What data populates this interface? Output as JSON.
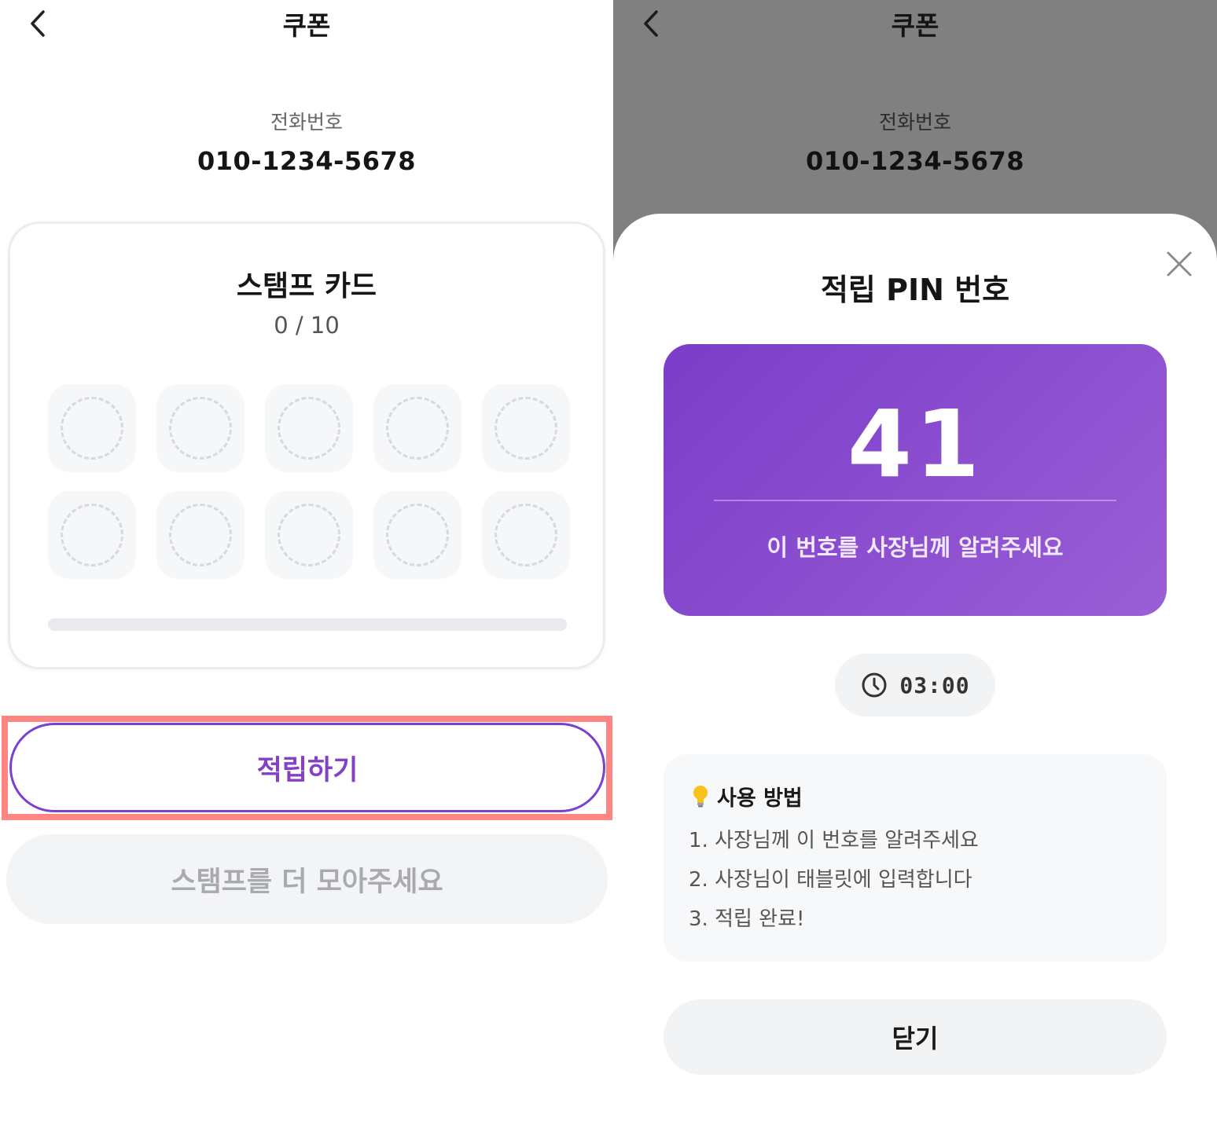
{
  "left": {
    "header": {
      "title": "쿠폰"
    },
    "phone": {
      "label": "전화번호",
      "value": "010-1234-5678"
    },
    "stamp_card": {
      "title": "스탬프 카드",
      "count_text": "0 / 10",
      "collected": 0,
      "total": 10,
      "progress_fraction": 0
    },
    "buttons": {
      "earn_label": "적립하기",
      "collect_more_label": "스탬프를 더 모아주세요"
    }
  },
  "right": {
    "header": {
      "title": "쿠폰"
    },
    "phone": {
      "label": "전화번호",
      "value": "010-1234-5678"
    },
    "modal": {
      "title": "적립 PIN 번호",
      "pin": "41",
      "pin_hint": "이 번호를 사장님께 알려주세요",
      "timer": "03:00",
      "howto": {
        "title": "사용 방법",
        "steps": [
          "1. 사장님께 이 번호를 알려주세요",
          "2. 사장님이 태블릿에 입력합니다",
          "3. 적립 완료!"
        ]
      },
      "close_label": "닫기"
    }
  },
  "colors": {
    "accent": "#8540c9",
    "pin_gradient_start": "#7b3dc8",
    "pin_gradient_end": "#9a5ed6",
    "highlight": "#ff8583",
    "dim_overlay": "#808080"
  },
  "icons": [
    "chevron-left-icon",
    "close-icon",
    "clock-icon",
    "lightbulb-icon"
  ]
}
